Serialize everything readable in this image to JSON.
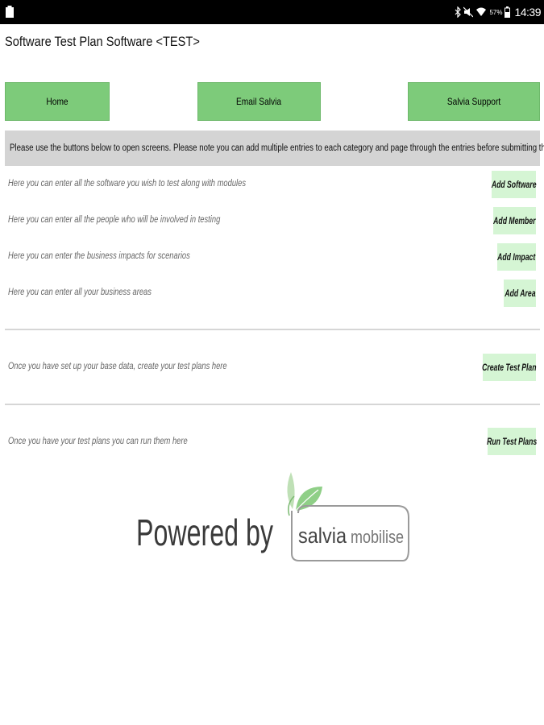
{
  "status_bar": {
    "time": "14:39",
    "battery_percent": "57%",
    "icons": [
      "bluetooth-icon",
      "mute-icon",
      "wifi-icon",
      "battery-icon"
    ]
  },
  "app": {
    "title": "Software Test Plan Software <TEST>"
  },
  "nav": {
    "home_label": "Home",
    "email_label": "Email Salvia",
    "support_label": "Salvia Support"
  },
  "notice": "Please use the buttons below to open screens. Please note you can add multiple entries to each category and page through the entries before submitting them.",
  "base_rows": [
    {
      "text": "Here you can enter all the software you wish to test along with modules",
      "button": "Add Software"
    },
    {
      "text": "Here you can enter all the people who will be involved in testing",
      "button": "Add Member"
    },
    {
      "text": "Here you can enter the business impacts for scenarios",
      "button": "Add Impact"
    },
    {
      "text": "Here you can enter all your business areas",
      "button": "Add Area"
    }
  ],
  "plans": {
    "text": "Once you have set up your base data, create your test plans here",
    "button": "Create Test Plan"
  },
  "run": {
    "text": "Once you have your test plans you can run them here",
    "button": "Run Test Plans"
  },
  "logo": {
    "powered": "Powered by",
    "brand": "salvia",
    "product": "mobilise"
  },
  "colors": {
    "nav_button": "#7dcb7a",
    "action_button": "#d5f5d4",
    "notice_bg": "#d4d4d4",
    "status_bar": "#000000"
  }
}
